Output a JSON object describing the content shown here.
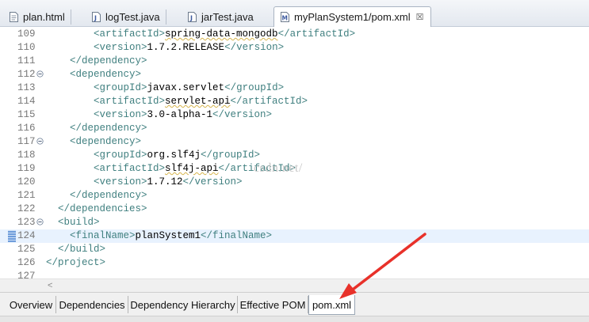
{
  "editor_tabs": [
    {
      "label": "plan.html",
      "icon": "html-file-icon",
      "active": false
    },
    {
      "label": "logTest.java",
      "icon": "java-file-icon",
      "active": false
    },
    {
      "label": "jarTest.java",
      "icon": "java-file-icon",
      "active": false
    },
    {
      "label": "myPlanSystem1/pom.xml",
      "icon": "maven-pom-icon",
      "active": true,
      "close": "☒"
    }
  ],
  "lines": [
    {
      "n": "109",
      "code": "        <artifactId>spring-data-mongodb</artifactId>"
    },
    {
      "n": "110",
      "code": "        <version>1.7.2.RELEASE</version>"
    },
    {
      "n": "111",
      "code": "    </dependency>"
    },
    {
      "n": "112",
      "code": "    <dependency>",
      "fold": true
    },
    {
      "n": "113",
      "code": "        <groupId>javax.servlet</groupId>"
    },
    {
      "n": "114",
      "code": "        <artifactId>servlet-api</artifactId>"
    },
    {
      "n": "115",
      "code": "        <version>3.0-alpha-1</version>"
    },
    {
      "n": "116",
      "code": "    </dependency>"
    },
    {
      "n": "117",
      "code": "    <dependency>",
      "fold": true
    },
    {
      "n": "118",
      "code": "        <groupId>org.slf4j</groupId>"
    },
    {
      "n": "119",
      "code": "        <artifactId>slf4j-api</artifactId>"
    },
    {
      "n": "120",
      "code": "        <version>1.7.12</version>"
    },
    {
      "n": "121",
      "code": "    </dependency>"
    },
    {
      "n": "122",
      "code": "  </dependencies>"
    },
    {
      "n": "123",
      "code": "  <build>",
      "fold": true
    },
    {
      "n": "124",
      "code": "    <finalName>planSystem1</finalName>",
      "current": true
    },
    {
      "n": "125",
      "code": "  </build>"
    },
    {
      "n": "126",
      "code": "</project>"
    },
    {
      "n": "127",
      "code": ""
    }
  ],
  "watermark": "csdn.net/",
  "scroll_arrow": "<",
  "page_tabs": [
    {
      "label": "Overview",
      "active": false
    },
    {
      "label": "Dependencies",
      "active": false
    },
    {
      "label": "Dependency Hierarchy",
      "active": false
    },
    {
      "label": "Effective POM",
      "active": false
    },
    {
      "label": "pom.xml",
      "active": true
    }
  ],
  "colors": {
    "tag": "#3f7f7f",
    "annotation_arrow": "#e8312a",
    "current_line": "#e8f2fe"
  }
}
